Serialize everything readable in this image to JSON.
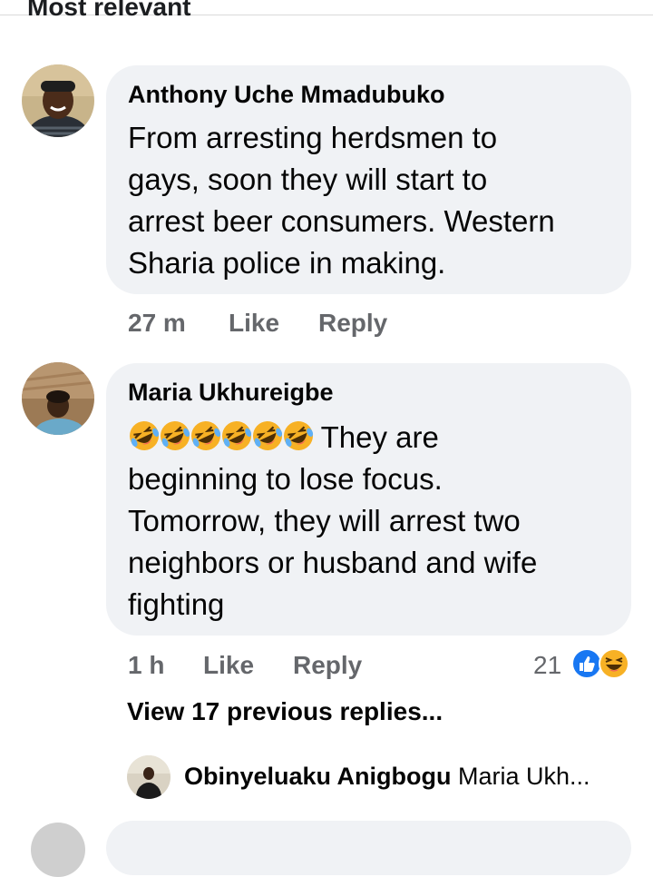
{
  "sort_label": "Most relevant",
  "comments": [
    {
      "author": "Anthony Uche Mmadubuko",
      "text_lines": [
        "From arresting herdsmen to",
        "gays, soon they will start to",
        "arrest beer consumers. Western",
        "Sharia police in making."
      ],
      "time": "27 m",
      "like_label": "Like",
      "reply_label": "Reply"
    },
    {
      "author": "Maria Ukhureigbe",
      "emoji_name": "rolling-on-floor-laughing",
      "emoji_count": 6,
      "first_line_text": "They are",
      "text_lines": [
        "beginning to lose focus.",
        "Tomorrow, they will arrest two",
        "neighbors or husband and wife",
        "fighting"
      ],
      "time": "1 h",
      "like_label": "Like",
      "reply_label": "Reply",
      "reaction_count": "21",
      "reaction_icons": [
        "like-icon",
        "haha-icon"
      ]
    }
  ],
  "view_previous_replies": "View 17 previous replies...",
  "latest_reply": {
    "author": "Obinyeluaku Anigbogu",
    "text": "Maria Ukh..."
  }
}
